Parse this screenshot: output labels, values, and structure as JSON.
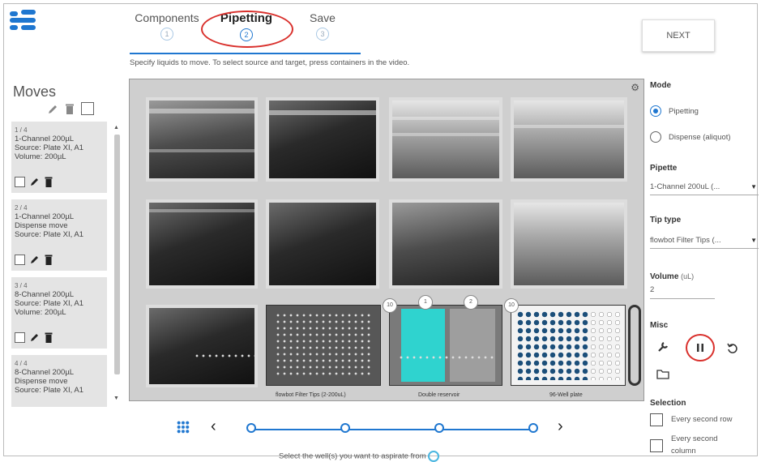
{
  "header": {
    "steps": [
      {
        "label": "Components",
        "num": "1"
      },
      {
        "label": "Pipetting",
        "num": "2"
      },
      {
        "label": "Save",
        "num": "3"
      }
    ],
    "instructions": "Specify liquids to move. To select source and target, press containers in the video.",
    "next_label": "NEXT"
  },
  "moves": {
    "title": "Moves",
    "items": [
      {
        "count": "1 / 4",
        "lines": [
          "1-Channel 200µL",
          "Source: Plate XI, A1",
          "Volume: 200µL"
        ]
      },
      {
        "count": "2 / 4",
        "lines": [
          "1-Channel 200µL",
          "Dispense move",
          "Source: Plate XI, A1"
        ]
      },
      {
        "count": "3 / 4",
        "lines": [
          "8-Channel 200µL",
          "Source: Plate XI, A1",
          "Volume: 200µL"
        ]
      },
      {
        "count": "4 / 4",
        "lines": [
          "8-Channel 200µL",
          "Dispense move",
          "Source: Plate XI, A1"
        ]
      }
    ]
  },
  "video": {
    "plate_labels": [
      "flowbot Filter Tips (2-200uL)",
      "Double reservoir",
      "96-Well plate"
    ],
    "badges": [
      "10",
      "1",
      "2",
      "10"
    ],
    "reservoir_color": "#2fd3cf"
  },
  "bottom": {
    "hint": "Select the well(s) you want to aspirate from"
  },
  "panel": {
    "mode_title": "Mode",
    "mode_options": [
      "Pipetting",
      "Dispense (aliquot)"
    ],
    "pipette_title": "Pipette",
    "pipette_value": "1-Channel 200uL (...",
    "tip_title": "Tip type",
    "tip_value": "flowbot Filter Tips (...",
    "volume_title": "Volume",
    "volume_unit": "(uL)",
    "volume_value": "2",
    "misc_title": "Misc",
    "selection_title": "Selection",
    "selection_options": [
      "Every second row",
      "Every second column"
    ]
  },
  "colors": {
    "accent": "#1f77d0",
    "highlight": "#d9302c"
  }
}
